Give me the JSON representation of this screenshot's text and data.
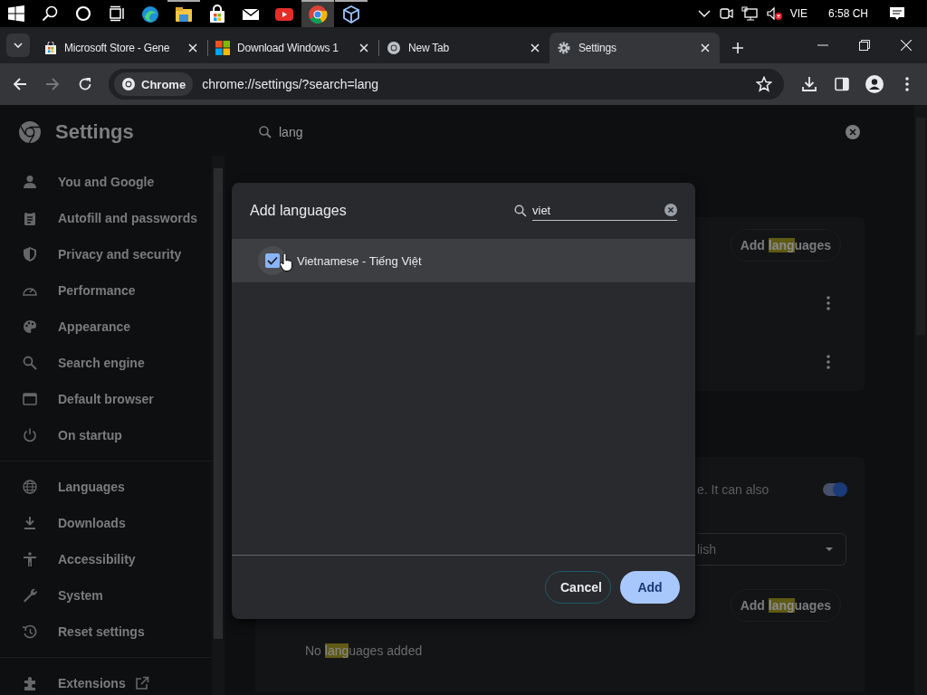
{
  "taskbar": {
    "apps": [
      {
        "running": false,
        "selected": false
      },
      {
        "running": true,
        "selected": false
      },
      {
        "running": false,
        "selected": false
      },
      {
        "running": false,
        "selected": false
      },
      {
        "running": false,
        "selected": false
      },
      {
        "running": true,
        "selected": true
      },
      {
        "running": true,
        "selected": false
      }
    ],
    "tray": {
      "language": "VIE",
      "time": "6:58 CH"
    }
  },
  "tabs": [
    {
      "title": "Microsoft Store - Gene",
      "selected": false
    },
    {
      "title": "Download Windows 1",
      "selected": false
    },
    {
      "title": "New Tab",
      "selected": false
    },
    {
      "title": "Settings",
      "selected": true
    }
  ],
  "toolbar": {
    "back": {
      "disabled": false
    },
    "forward": {
      "disabled": true
    },
    "chip": "Chrome",
    "url": "chrome://settings/?search=lang"
  },
  "settings": {
    "title": "Settings",
    "search": {
      "value": "lang"
    },
    "sidebar": {
      "groups": [
        [
          {
            "label": "You and Google",
            "kind": "page"
          },
          {
            "label": "Autofill and passwords",
            "kind": "page"
          },
          {
            "label": "Privacy and security",
            "kind": "page"
          },
          {
            "label": "Performance",
            "kind": "page"
          },
          {
            "label": "Appearance",
            "kind": "page"
          },
          {
            "label": "Search engine",
            "kind": "page"
          },
          {
            "label": "Default browser",
            "kind": "page"
          },
          {
            "label": "On startup",
            "kind": "page"
          }
        ],
        [
          {
            "label": "Languages",
            "kind": "page"
          },
          {
            "label": "Downloads",
            "kind": "page"
          },
          {
            "label": "Accessibility",
            "kind": "page"
          },
          {
            "label": "System",
            "kind": "page"
          },
          {
            "label": "Reset settings",
            "kind": "page"
          }
        ],
        [
          {
            "label": "Extensions",
            "kind": "external"
          }
        ]
      ]
    },
    "cards": [
      [
        {
          "kind": "button",
          "parts": [
            {
              "text": "Add ",
              "highlight": false
            },
            {
              "text": "lang",
              "highlight": true
            },
            {
              "text": "uages",
              "highlight": false
            }
          ]
        },
        {
          "kind": "menu"
        },
        {
          "kind": "menu"
        }
      ],
      [
        {
          "kind": "toggle",
          "text": "e. It can also",
          "on": true
        },
        {
          "kind": "dropdown",
          "value": "lish"
        },
        {
          "kind": "button",
          "parts": [
            {
              "text": "Add ",
              "highlight": false
            },
            {
              "text": "lang",
              "highlight": true
            },
            {
              "text": "uages",
              "highlight": false
            }
          ]
        },
        {
          "kind": "note",
          "parts": [
            {
              "text": "No ",
              "highlight": false
            },
            {
              "text": "lang",
              "highlight": true
            },
            {
              "text": "uages added",
              "highlight": false
            }
          ]
        }
      ]
    ]
  },
  "dialog": {
    "title": "Add languages",
    "search": {
      "value": "viet"
    },
    "languages": [
      {
        "label": "Vietnamese - Tiếng Việt",
        "checked": true,
        "hovered": true
      }
    ],
    "buttons": [
      {
        "label": "Cancel",
        "kind": "secondary"
      },
      {
        "label": "Add",
        "kind": "primary"
      }
    ]
  }
}
